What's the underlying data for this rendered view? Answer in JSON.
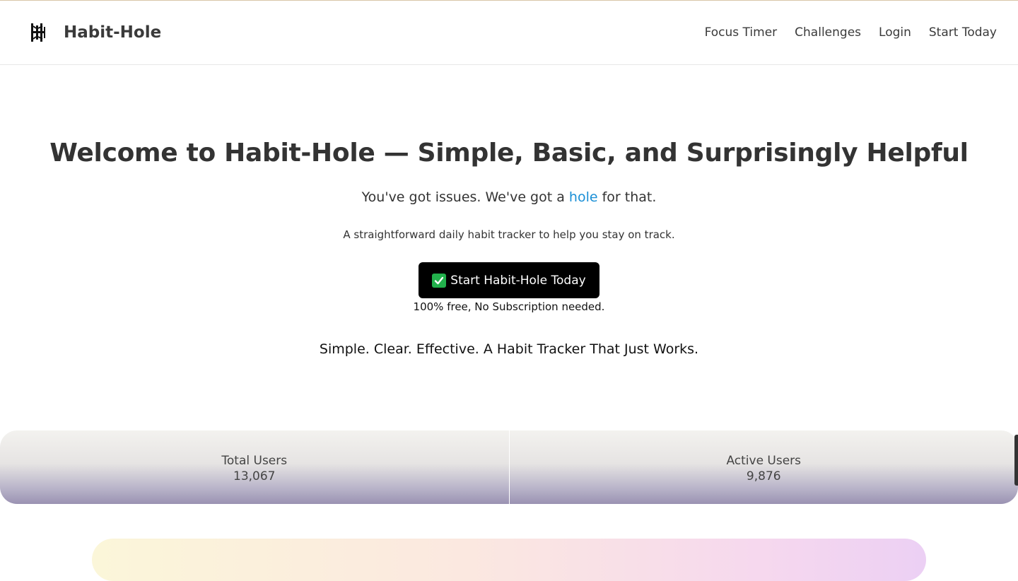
{
  "header": {
    "brand": "Habit-Hole",
    "logo_icon": "habit-hole-logo-icon",
    "nav": [
      {
        "label": "Focus Timer"
      },
      {
        "label": "Challenges"
      },
      {
        "label": "Login"
      },
      {
        "label": "Start Today"
      }
    ]
  },
  "hero": {
    "title": "Welcome to Habit-Hole — Simple, Basic, and Surprisingly Helpful",
    "subtitle_before": "You've got issues. We've got a ",
    "subtitle_link": "hole",
    "subtitle_after": " for that.",
    "description": "A straightforward daily habit tracker to help you stay on track.",
    "cta_label": "Start Habit-Hole Today",
    "cta_icon": "check-box-icon",
    "cta_note": "100% free, No Subscription needed.",
    "tagline": "Simple. Clear. Effective. A Habit Tracker That Just Works."
  },
  "stats": [
    {
      "label": "Total Users",
      "value": "13,067"
    },
    {
      "label": "Active Users",
      "value": "9,876"
    }
  ],
  "colors": {
    "link": "#1a8fd6",
    "cta_bg": "#000000",
    "check": "#22b14c",
    "text": "#333333"
  }
}
